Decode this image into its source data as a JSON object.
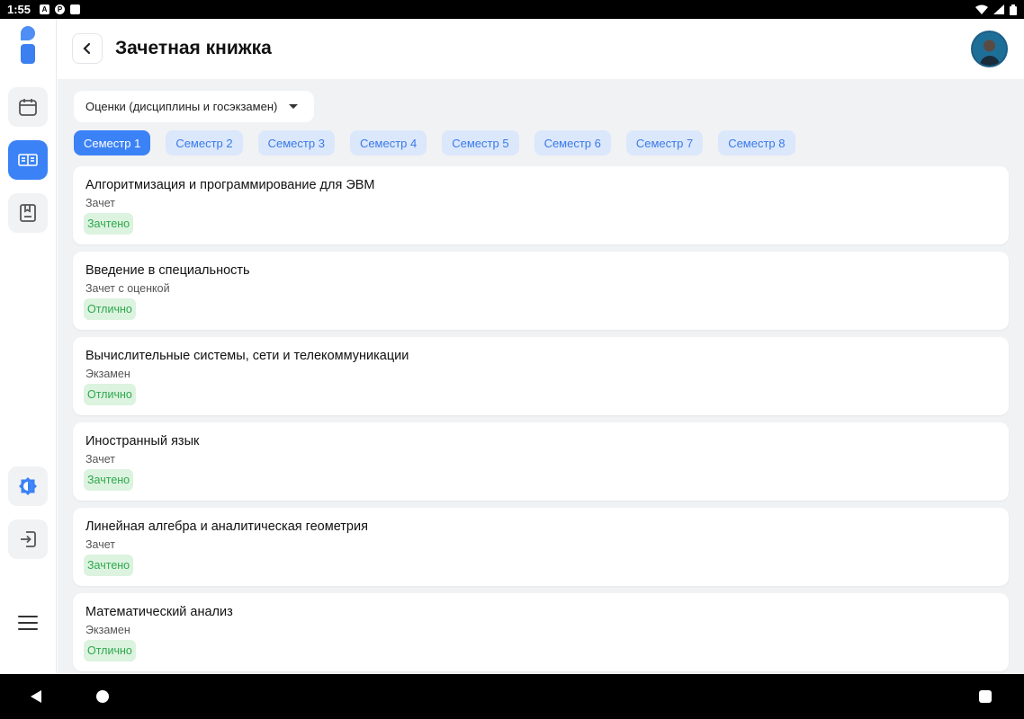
{
  "status_bar": {
    "time": "1:55",
    "left_icons": [
      "a-icon",
      "p-icon",
      "sd-card-icon"
    ],
    "right_icons": [
      "wifi-icon",
      "signal-icon",
      "battery-icon"
    ]
  },
  "header": {
    "title": "Зачетная книжка"
  },
  "filter": {
    "selected": "Оценки (дисциплины и госэкзамен)"
  },
  "semesters": [
    "Семестр 1",
    "Семестр 2",
    "Семестр 3",
    "Семестр 4",
    "Семестр 5",
    "Семестр 6",
    "Семестр 7",
    "Семестр 8"
  ],
  "active_semester": "Семестр 1",
  "courses": [
    {
      "name": "Алгоритмизация и программирование для ЭВМ",
      "type": "Зачет",
      "grade": "Зачтено"
    },
    {
      "name": "Введение в специальность",
      "type": "Зачет с оценкой",
      "grade": "Отлично"
    },
    {
      "name": "Вычислительные системы, сети и телекоммуникации",
      "type": "Экзамен",
      "grade": "Отлично"
    },
    {
      "name": "Иностранный язык",
      "type": "Зачет",
      "grade": "Зачтено"
    },
    {
      "name": "Линейная алгебра и аналитическая геометрия",
      "type": "Зачет",
      "grade": "Зачтено"
    },
    {
      "name": "Математический анализ",
      "type": "Экзамен",
      "grade": "Отлично"
    }
  ],
  "colors": {
    "accent": "#3b82f6",
    "tab_inactive_bg": "#dbe7fb",
    "badge_bg": "#dcf3df",
    "badge_text": "#2fa84f",
    "content_bg": "#f1f2f4"
  },
  "rail_icons": [
    "calendar-icon",
    "gradebook-icon",
    "bookmark-icon",
    "theme-icon",
    "logout-icon",
    "menu-icon"
  ]
}
